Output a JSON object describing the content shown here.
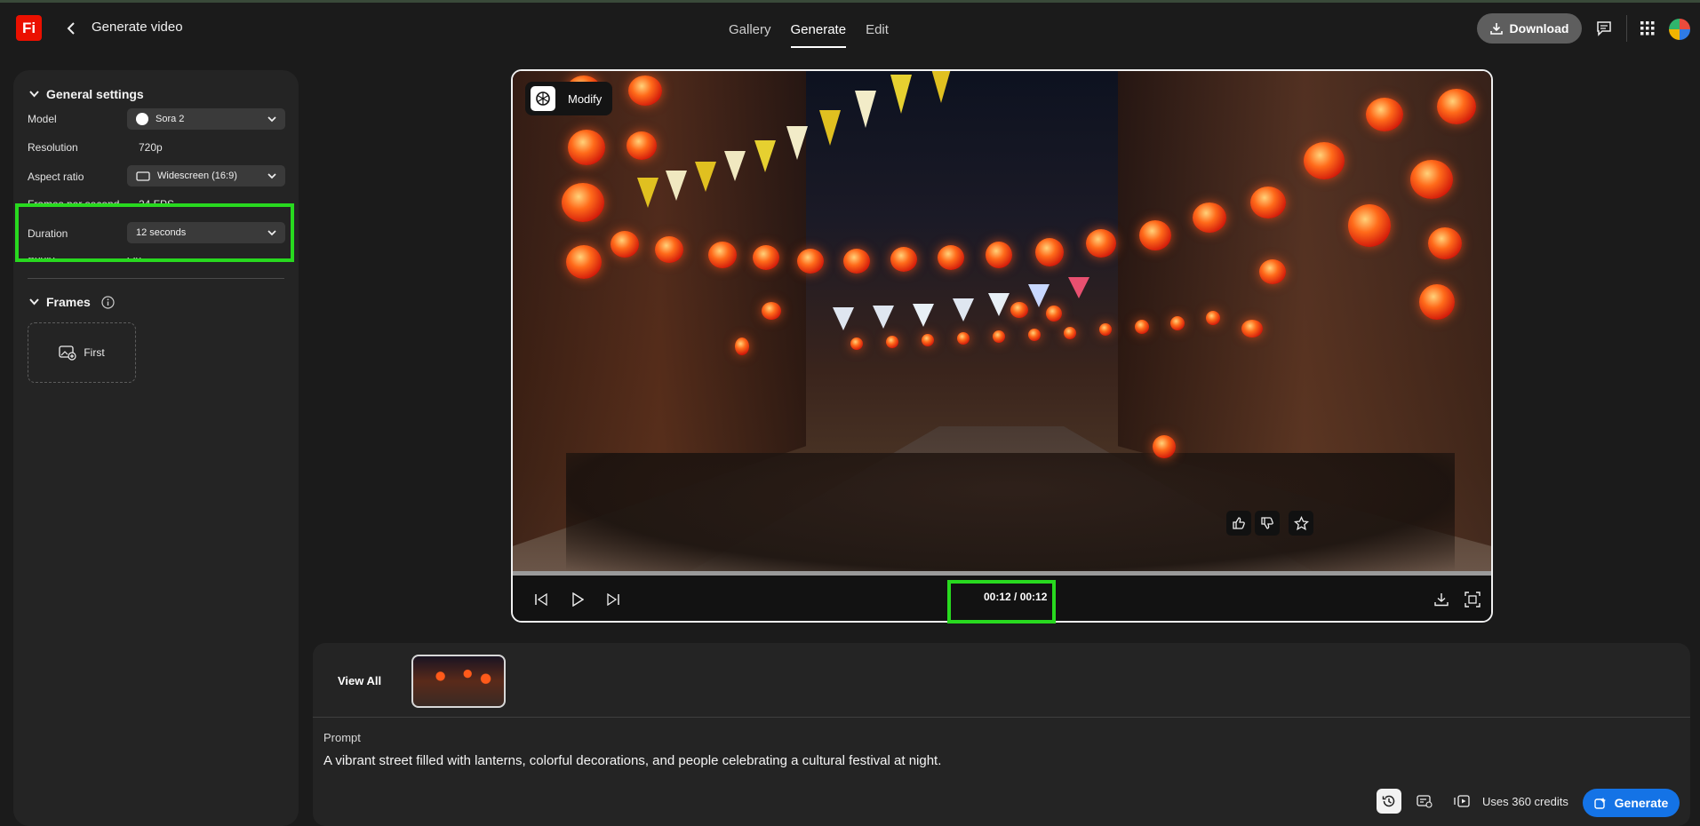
{
  "app": {
    "logo": "Fi",
    "title": "Generate video"
  },
  "nav": {
    "tabs": [
      {
        "label": "Gallery"
      },
      {
        "label": "Generate"
      },
      {
        "label": "Edit"
      }
    ],
    "active": "Generate"
  },
  "header": {
    "download_label": "Download",
    "icons": [
      "chat-icon",
      "apps-grid-icon",
      "avatar"
    ]
  },
  "general_settings": {
    "title": "General settings",
    "model": {
      "label": "Model",
      "value": "Sora 2"
    },
    "resolution": {
      "label": "Resolution",
      "value": "720p"
    },
    "aspect_ratio": {
      "label": "Aspect ratio",
      "value": "Widescreen (16:9)"
    },
    "fps": {
      "label": "Frames per second",
      "value": "24 FPS"
    },
    "duration": {
      "label": "Duration",
      "value": "12 seconds"
    },
    "audio": {
      "label": "Audio",
      "value": "On"
    }
  },
  "frames": {
    "title": "Frames",
    "first_label": "First"
  },
  "video": {
    "modify_label": "Modify",
    "current_time": "00:12",
    "total_time": "00:12",
    "time_display": "00:12 / 00:12",
    "progress_percent": 100
  },
  "bottom": {
    "view_all_label": "View All",
    "prompt_label": "Prompt",
    "prompt_text": "A vibrant street filled with lanterns, colorful decorations, and people celebrating a cultural festival at night.",
    "credits_text": "Uses 360 credits",
    "generate_label": "Generate"
  },
  "colors": {
    "accent": "#1473e6",
    "highlight": "#28d91f",
    "brand": "#eb1000"
  }
}
